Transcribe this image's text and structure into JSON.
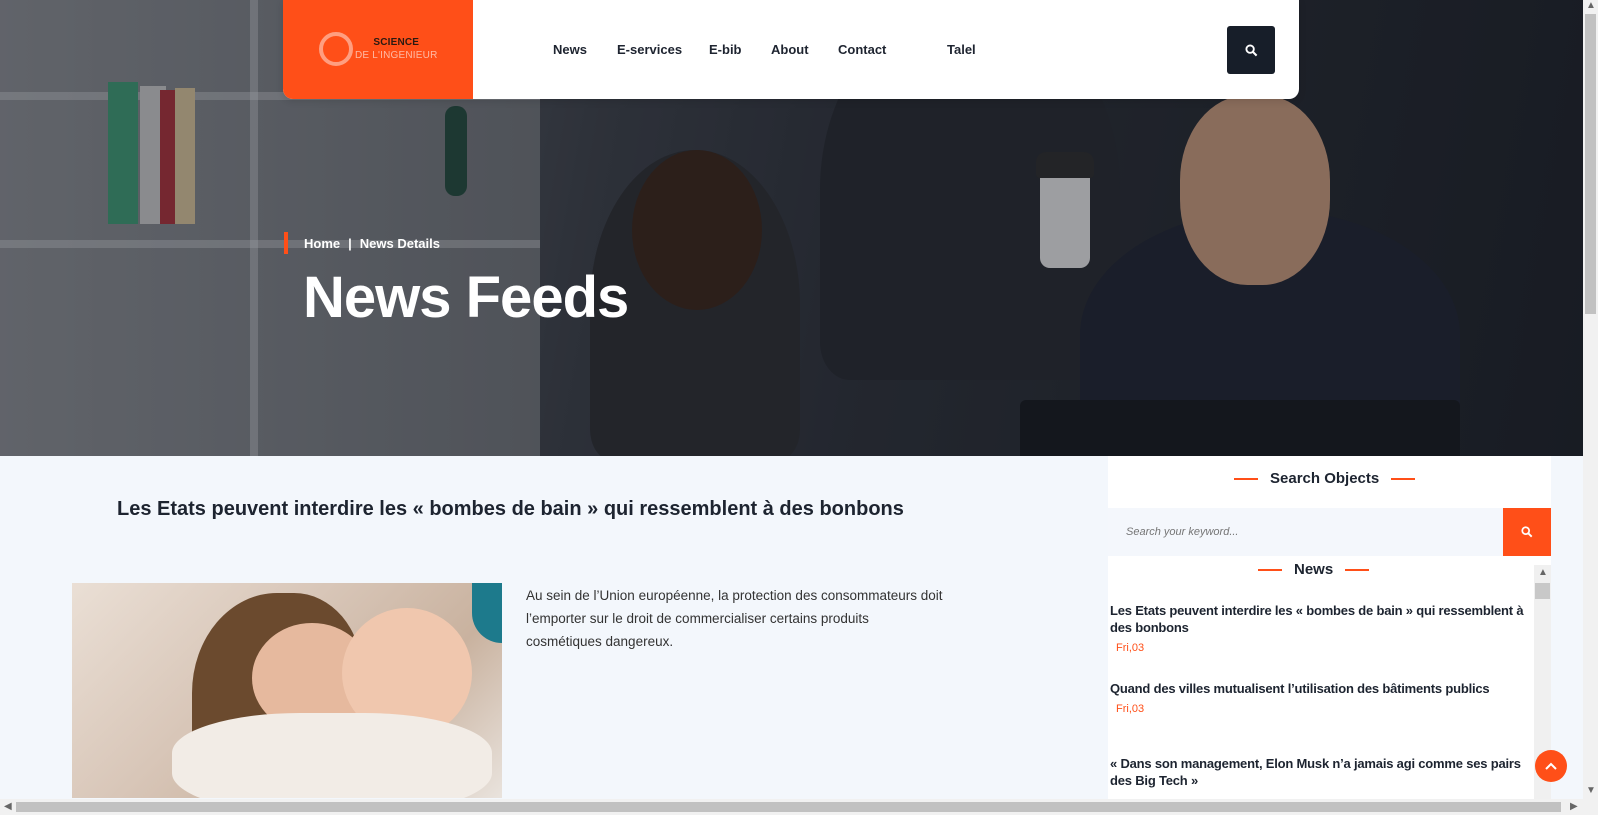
{
  "header": {
    "logo_line1": "SCIENCE",
    "logo_line2": "DE L'INGENIEUR",
    "nav": [
      "News",
      "E-services",
      "E-bib",
      "About",
      "Contact",
      "Talel"
    ]
  },
  "hero": {
    "breadcrumb_home": "Home",
    "breadcrumb_sep": "|",
    "breadcrumb_current": "News Details",
    "title": "News Feeds"
  },
  "article": {
    "title": "Les Etats peuvent interdire les « bombes de bain » qui ressemblent à des bonbons",
    "body": "Au sein de l’Union européenne, la protection des consommateurs doit l’emporter sur le droit de commercialiser certains produits cosmétiques dangereux."
  },
  "sidebar": {
    "search_heading": "Search Objects",
    "search_placeholder": "Search your keyword...",
    "news_heading": "News",
    "news": [
      {
        "title": "Les Etats peuvent interdire les « bombes de bain » qui ressemblent à des bonbons",
        "date": "Fri,03"
      },
      {
        "title": "Quand des villes mutualisent l’utilisation des bâtiments publics",
        "date": "Fri,03"
      },
      {
        "title": "« Dans son management, Elon Musk n’a jamais agi comme ses pairs des Big Tech »",
        "date": ""
      }
    ]
  },
  "colors": {
    "accent": "#ff4f18",
    "dark": "#171e29"
  }
}
